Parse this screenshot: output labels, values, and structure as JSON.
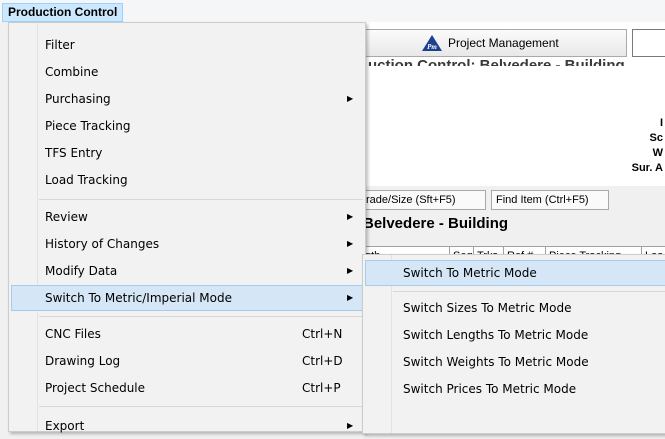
{
  "menubar": {
    "title": "Production Control"
  },
  "background": {
    "toolbar_button": "Project Management",
    "logo_text": "Pm",
    "title_partial": "uction Control: Belvedere - Building",
    "info_lines": [
      "I",
      "Sc",
      "W",
      "Sur. A"
    ],
    "buttons": [
      "rade/Size (Sft+F5)",
      "Find Item (Ctrl+F5)"
    ],
    "building_label": "Belvedere - Building",
    "grid_headers": [
      "gth",
      "Seq",
      "Trks",
      "Ref #",
      "Piece Tracking",
      "Loa"
    ]
  },
  "menu": {
    "items": [
      {
        "label": "Filter",
        "shortcut": "",
        "has_submenu": false
      },
      {
        "label": "Combine",
        "shortcut": "",
        "has_submenu": false
      },
      {
        "label": "Purchasing",
        "shortcut": "",
        "has_submenu": true
      },
      {
        "label": "Piece Tracking",
        "shortcut": "",
        "has_submenu": false
      },
      {
        "label": "TFS Entry",
        "shortcut": "",
        "has_submenu": false
      },
      {
        "label": "Load Tracking",
        "shortcut": "",
        "has_submenu": false
      },
      {
        "label": "Review",
        "shortcut": "",
        "has_submenu": true
      },
      {
        "label": "History of Changes",
        "shortcut": "",
        "has_submenu": true
      },
      {
        "label": "Modify Data",
        "shortcut": "",
        "has_submenu": true
      },
      {
        "label": "Switch To Metric/Imperial Mode",
        "shortcut": "",
        "has_submenu": true
      },
      {
        "label": "CNC Files",
        "shortcut": "Ctrl+N",
        "has_submenu": false
      },
      {
        "label": "Drawing Log",
        "shortcut": "Ctrl+D",
        "has_submenu": false
      },
      {
        "label": "Project Schedule",
        "shortcut": "Ctrl+P",
        "has_submenu": false
      },
      {
        "label": "Export",
        "shortcut": "",
        "has_submenu": true
      }
    ]
  },
  "submenu": {
    "items": [
      "Switch To Metric Mode",
      "Switch Sizes To Metric Mode",
      "Switch Lengths To Metric Mode",
      "Switch Weights To Metric Mode",
      "Switch Prices To Metric Mode"
    ]
  },
  "colors": {
    "highlight": "#d5e6f7",
    "highlight_border": "#a8caec",
    "menubar_active": "#cce8ff"
  }
}
